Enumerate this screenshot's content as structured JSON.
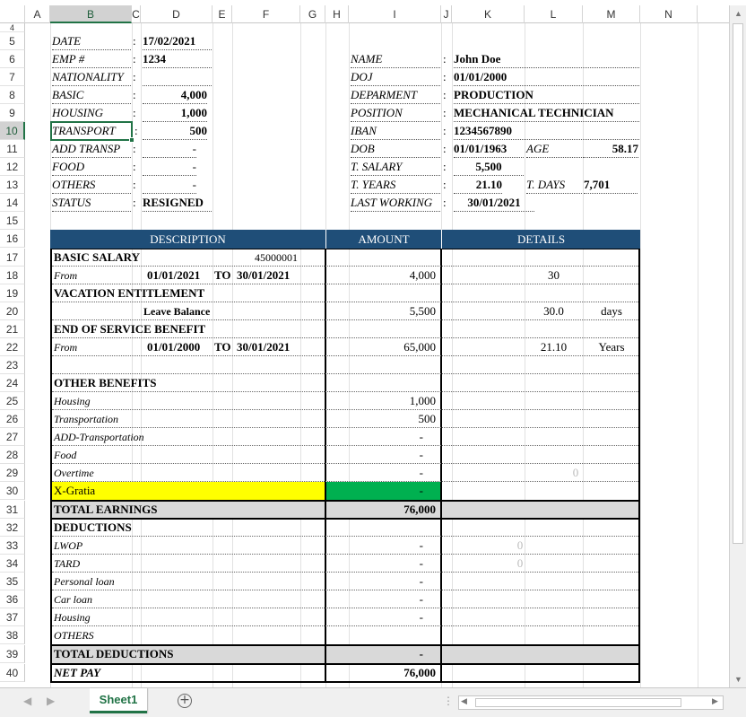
{
  "columns": [
    "A",
    "B",
    "C",
    "D",
    "E",
    "F",
    "G",
    "H",
    "I",
    "J",
    "K",
    "L",
    "M",
    "N"
  ],
  "rows": [
    "4",
    "5",
    "6",
    "7",
    "8",
    "9",
    "10",
    "11",
    "12",
    "13",
    "14",
    "15",
    "16",
    "17",
    "18",
    "19",
    "20",
    "21",
    "22",
    "23",
    "24",
    "25",
    "26",
    "27",
    "28",
    "29",
    "30",
    "31",
    "32",
    "33",
    "34",
    "35",
    "36",
    "37",
    "38",
    "39",
    "40"
  ],
  "left_info": [
    {
      "label": "DATE",
      "value": "17/02/2021",
      "align": "left"
    },
    {
      "label": "EMP #",
      "value": "1234",
      "align": "left"
    },
    {
      "label": "NATIONALITY",
      "value": "",
      "align": "left"
    },
    {
      "label": "BASIC",
      "value": "4,000",
      "align": "right"
    },
    {
      "label": "HOUSING",
      "value": "1,000",
      "align": "right"
    },
    {
      "label": "TRANSPORT",
      "value": "500",
      "align": "right"
    },
    {
      "label": "ADD TRANSP",
      "value": "-",
      "align": "right"
    },
    {
      "label": "FOOD",
      "value": "-",
      "align": "right"
    },
    {
      "label": "OTHERS",
      "value": "-",
      "align": "right"
    },
    {
      "label": "STATUS",
      "value": "RESIGNED",
      "align": "left"
    }
  ],
  "right_info": [
    {
      "label": "NAME",
      "value": "John Doe"
    },
    {
      "label": "DOJ",
      "value": "01/01/2000"
    },
    {
      "label": "DEPARMENT",
      "value": "PRODUCTION"
    },
    {
      "label": "POSITION",
      "value": "MECHANICAL TECHNICIAN"
    },
    {
      "label": "IBAN",
      "value": "1234567890"
    },
    {
      "label": "DOB",
      "value": "01/01/1963"
    },
    {
      "label": "T. SALARY",
      "value": "5,500"
    },
    {
      "label": "T. YEARS",
      "value": "21.10"
    },
    {
      "label": "LAST WORKING",
      "value": "30/01/2021"
    }
  ],
  "extra": {
    "age_label": "AGE",
    "age_value": "58.17",
    "tdays_label": "T. DAYS",
    "tdays_value": "7,701",
    "colon": ":"
  },
  "table_headers": {
    "description": "DESCRIPTION",
    "amount": "AMOUNT",
    "details": "DETAILS"
  },
  "table": {
    "basic_salary": "BASIC SALARY",
    "basic_code": "45000001",
    "from": "From",
    "from1": "01/01/2021",
    "to": "TO",
    "to1": "30/01/2021",
    "amt18": "4,000",
    "det18": "30",
    "vacation": "VACATION ENTITLEMENT",
    "leave_balance": "Leave Balance",
    "amt20": "5,500",
    "det20": "30.0",
    "days": "days",
    "eosb": "END OF SERVICE BENEFIT",
    "from2": "01/01/2000",
    "to2": "30/01/2021",
    "amt22": "65,000",
    "det22": "21.10",
    "years": "Years",
    "other_benefits": "OTHER BENEFITS",
    "housing": "Housing",
    "amt25": "1,000",
    "transportation": "Transportation",
    "amt26": "500",
    "add_transport": "ADD-Transportation",
    "amt27": "-",
    "food": "Food",
    "amt28": "-",
    "overtime": "Overtime",
    "amt29": "-",
    "det29": "0",
    "xgratia": "X-Gratia",
    "amt30": "-",
    "total_earnings": "TOTAL EARNINGS",
    "amt31": "76,000",
    "deductions": "DEDUCTIONS",
    "lwop": "LWOP",
    "amt33": "-",
    "det33": "0",
    "tard": "TARD",
    "amt34": "-",
    "det34": "0",
    "personal_loan": "Personal loan",
    "amt35": "-",
    "car_loan": "Car loan",
    "amt36": "-",
    "housing2": "Housing",
    "amt37": "-",
    "others": "OTHERS",
    "total_deductions": "TOTAL DEDUCTIONS",
    "amt39": "-",
    "net_pay": "NET PAY",
    "amt40": "76,000"
  },
  "sheet_tab": "Sheet1",
  "colors": {
    "header_blue": "#1f4e78",
    "xgratia_yellow": "#ffff00",
    "xgratia_green": "#00b050",
    "total_gray": "#d9d9d9",
    "excel_green": "#217346"
  }
}
